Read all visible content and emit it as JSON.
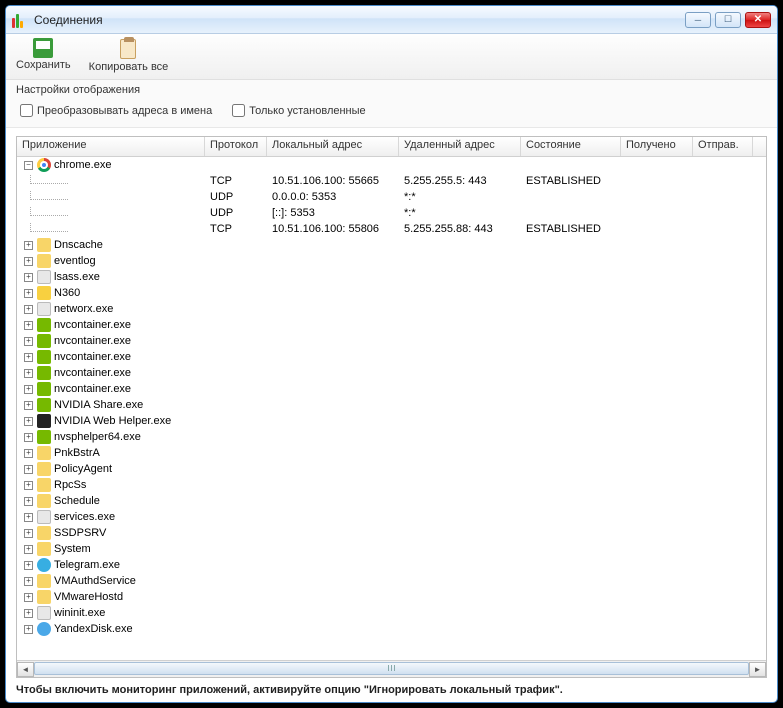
{
  "window": {
    "title": "Соединения"
  },
  "toolbar": {
    "save": "Сохранить",
    "copy_all": "Копировать все"
  },
  "settings": {
    "group_label": "Настройки отображения",
    "resolve_addresses": "Преобразовывать адреса в имена",
    "only_established": "Только установленные"
  },
  "columns": {
    "app": "Приложение",
    "proto": "Протокол",
    "local": "Локальный адрес",
    "remote": "Удаленный адрес",
    "state": "Состояние",
    "recv": "Получено",
    "sent": "Отправ."
  },
  "expanded": {
    "name": "chrome.exe",
    "connections": [
      {
        "proto": "TCP",
        "local": "10.51.106.100: 55665",
        "remote": "5.255.255.5: 443",
        "state": "ESTABLISHED"
      },
      {
        "proto": "UDP",
        "local": "0.0.0.0: 5353",
        "remote": "*:*",
        "state": ""
      },
      {
        "proto": "UDP",
        "local": "[::]: 5353",
        "remote": "*:*",
        "state": ""
      },
      {
        "proto": "TCP",
        "local": "10.51.106.100: 55806",
        "remote": "5.255.255.88: 443",
        "state": "ESTABLISHED"
      }
    ]
  },
  "apps": [
    {
      "name": "Dnscache",
      "icon": "folder"
    },
    {
      "name": "eventlog",
      "icon": "folder"
    },
    {
      "name": "lsass.exe",
      "icon": "exe"
    },
    {
      "name": "N360",
      "icon": "shield"
    },
    {
      "name": "networx.exe",
      "icon": "exe"
    },
    {
      "name": "nvcontainer.exe",
      "icon": "nvidia"
    },
    {
      "name": "nvcontainer.exe",
      "icon": "nvidia"
    },
    {
      "name": "nvcontainer.exe",
      "icon": "nvidia"
    },
    {
      "name": "nvcontainer.exe",
      "icon": "nvidia"
    },
    {
      "name": "nvcontainer.exe",
      "icon": "nvidia"
    },
    {
      "name": "NVIDIA Share.exe",
      "icon": "nvidia"
    },
    {
      "name": "NVIDIA Web Helper.exe",
      "icon": "nv-black"
    },
    {
      "name": "nvsphelper64.exe",
      "icon": "nvidia"
    },
    {
      "name": "PnkBstrA",
      "icon": "folder"
    },
    {
      "name": "PolicyAgent",
      "icon": "folder"
    },
    {
      "name": "RpcSs",
      "icon": "folder"
    },
    {
      "name": "Schedule",
      "icon": "folder"
    },
    {
      "name": "services.exe",
      "icon": "exe"
    },
    {
      "name": "SSDPSRV",
      "icon": "folder"
    },
    {
      "name": "System",
      "icon": "folder"
    },
    {
      "name": "Telegram.exe",
      "icon": "telegram"
    },
    {
      "name": "VMAuthdService",
      "icon": "folder"
    },
    {
      "name": "VMwareHostd",
      "icon": "folder"
    },
    {
      "name": "wininit.exe",
      "icon": "exe"
    },
    {
      "name": "YandexDisk.exe",
      "icon": "yandex"
    }
  ],
  "status": "Чтобы включить мониторинг приложений, активируйте опцию \"Игнорировать локальный трафик\"."
}
